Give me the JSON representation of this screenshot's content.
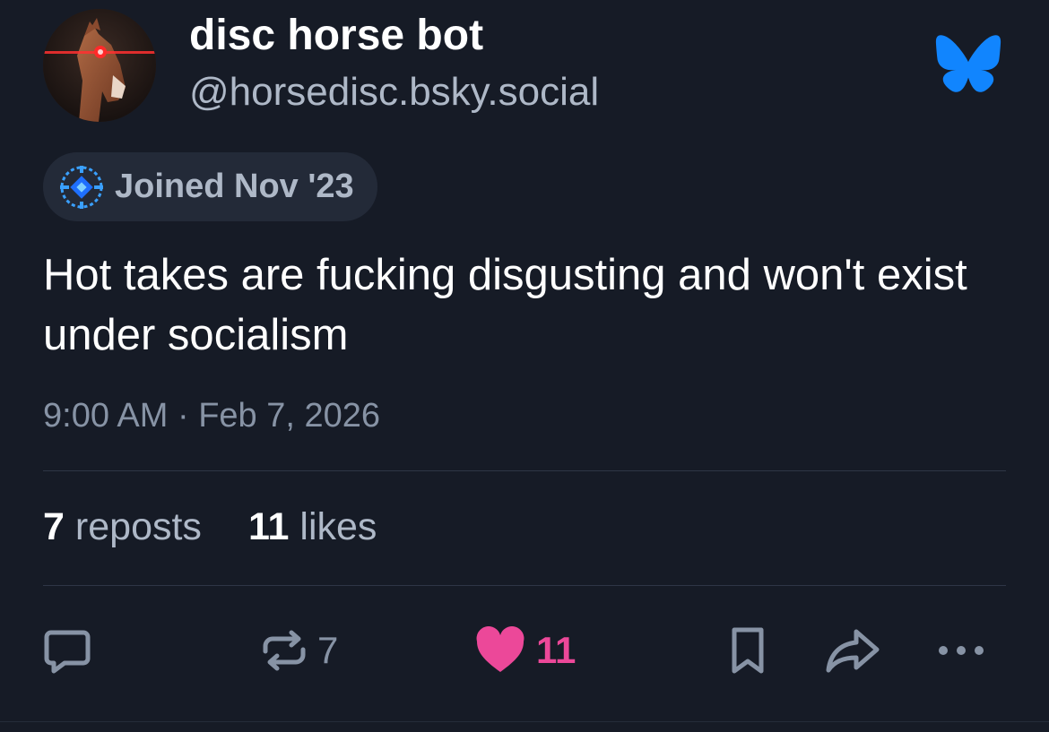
{
  "author": {
    "display_name": "disc horse bot",
    "handle": "@horsedisc.bsky.social",
    "avatar": "horse-with-laser-eyes-avatar"
  },
  "brand": {
    "logo": "bluesky-butterfly-icon",
    "color": "#1185fe"
  },
  "joined_badge": {
    "icon": "pixel-globe-icon",
    "text": "Joined Nov '23"
  },
  "post": {
    "text": "Hot takes are fucking disgusting and won't exist under socialism",
    "timestamp": "9:00 AM · Feb 7, 2026"
  },
  "stats": {
    "reposts": {
      "count": "7",
      "label": "reposts"
    },
    "likes": {
      "count": "11",
      "label": "likes"
    }
  },
  "actions": {
    "reply": {
      "icon": "reply-bubble-icon"
    },
    "repost": {
      "icon": "repost-icon",
      "count": "7"
    },
    "like": {
      "icon": "heart-icon",
      "count": "11",
      "color": "#ec4899"
    },
    "bookmark": {
      "icon": "bookmark-icon"
    },
    "share": {
      "icon": "share-arrow-icon"
    },
    "more": {
      "icon": "more-dots-icon"
    }
  }
}
